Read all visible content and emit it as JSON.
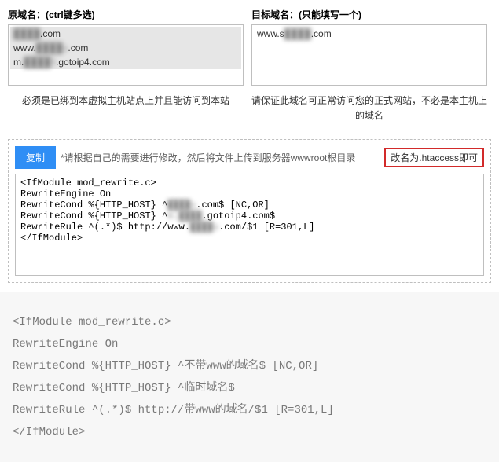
{
  "source": {
    "label": "原域名：(ctrl键多选)",
    "items": [
      {
        "text_pre": "",
        "obscured": "████",
        "text_post": ".com"
      },
      {
        "text_pre": "www.",
        "obscured": "████u",
        "text_post": ".com"
      },
      {
        "text_pre": "m.",
        "obscured": "████5",
        "text_post": ".gotoip4.com"
      }
    ],
    "hint": "必须是已绑到本虚拟主机站点上并且能访问到本站"
  },
  "target": {
    "label": "目标域名：(只能填写一个)",
    "value_pre": "www.s",
    "value_obscured": "████",
    "value_post": ".com",
    "hint": "请保证此域名可正常访问您的正式网站，不必是本主机上的域名"
  },
  "panel": {
    "copy_label": "复制",
    "note": "*请根据自己的需要进行修改，然后将文件上传到服务器wwwroot根目录",
    "badge": "改名为.htaccess即可"
  },
  "code_config": {
    "l1": "<IfModule mod_rewrite.c>",
    "l2": "RewriteEngine On",
    "l3a": "RewriteCond %{HTTP_HOST} ^",
    "l3b": ".com$ [NC,OR]",
    "l4a": "RewriteCond %{HTTP_HOST} ^",
    "l4b": ".gotoip4.com$",
    "l5a": "RewriteRule ^(.*)$ http://www.",
    "l5b": ".com/$1 [R=301,L]",
    "l6": "</IfModule>",
    "obs1": "████u",
    "obs2": "m.████",
    "obs3": "████u"
  },
  "explanation": {
    "lines": [
      "<IfModule mod_rewrite.c>",
      "RewriteEngine On",
      "RewriteCond %{HTTP_HOST} ^不带www的域名$ [NC,OR]",
      "RewriteCond %{HTTP_HOST} ^临时域名$",
      "RewriteRule ^(.*)$ http://带www的域名/$1 [R=301,L]",
      "</IfModule>"
    ]
  }
}
